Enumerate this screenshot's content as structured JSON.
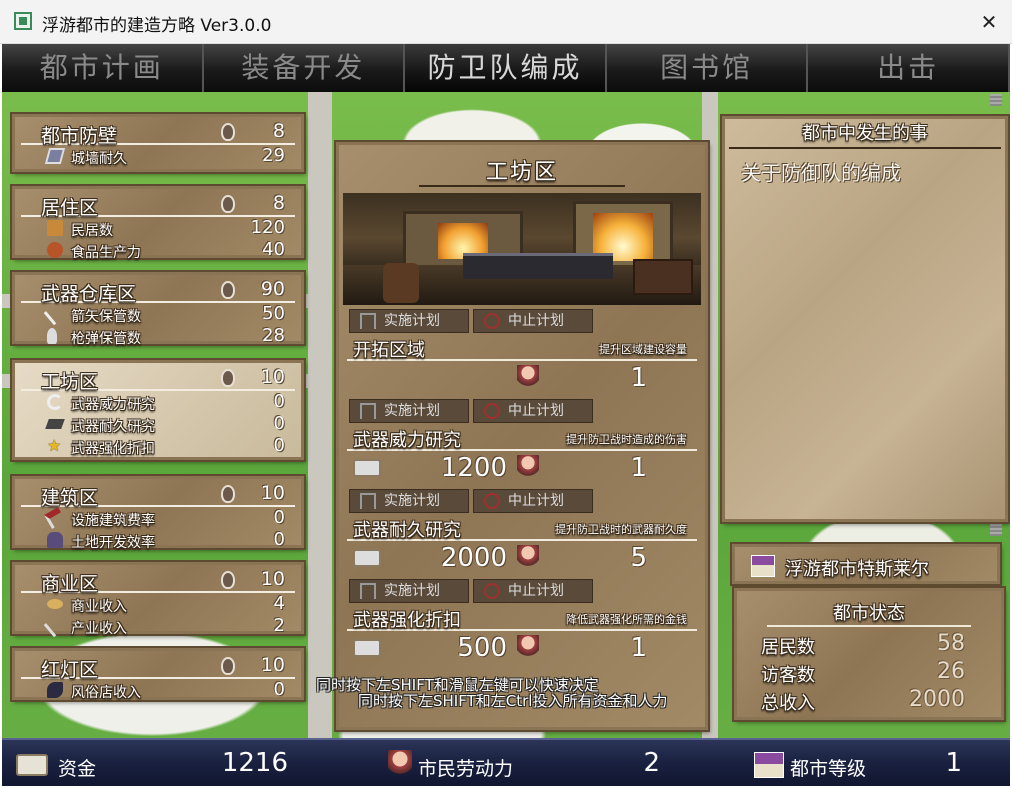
{
  "window": {
    "title": "浮游都市的建造方略 Ver3.0.0",
    "close_glyph": "✕"
  },
  "menu": [
    {
      "label": "都市计画",
      "active": false
    },
    {
      "label": "装备开发",
      "active": false
    },
    {
      "label": "防卫队编成",
      "active": true
    },
    {
      "label": "图书馆",
      "active": false
    },
    {
      "label": "出击",
      "active": false
    }
  ],
  "districts": [
    {
      "name": "都市防壁",
      "count": "8",
      "rows": [
        {
          "icon": "shield-icon",
          "label": "城墙耐久",
          "value": "29"
        }
      ]
    },
    {
      "name": "居住区",
      "count": "8",
      "rows": [
        {
          "icon": "house-icon",
          "label": "民居数",
          "value": "120"
        },
        {
          "icon": "bread-icon",
          "label": "食品生产力",
          "value": "40"
        }
      ]
    },
    {
      "name": "武器仓库区",
      "count": "90",
      "rows": [
        {
          "icon": "arrow-icon",
          "label": "箭矢保管数",
          "value": "50"
        },
        {
          "icon": "bullet-icon",
          "label": "枪弹保管数",
          "value": "28"
        }
      ]
    },
    {
      "name": "工坊区",
      "count": "10",
      "selected": true,
      "rows": [
        {
          "icon": "whetstone-icon",
          "label": "武器威力研究",
          "value": "0"
        },
        {
          "icon": "ingot-icon",
          "label": "武器耐久研究",
          "value": "0"
        },
        {
          "icon": "star-icon",
          "label": "武器强化折扣",
          "value": "0"
        }
      ]
    },
    {
      "name": "建筑区",
      "count": "10",
      "rows": [
        {
          "icon": "hammer-icon",
          "label": "设施建筑费率",
          "value": "0"
        },
        {
          "icon": "terrain-icon",
          "label": "土地开发效率",
          "value": "0"
        }
      ]
    },
    {
      "name": "商业区",
      "count": "10",
      "rows": [
        {
          "icon": "coin-icon",
          "label": "商业收入",
          "value": "4"
        },
        {
          "icon": "wrench-icon",
          "label": "产业收入",
          "value": "2"
        }
      ]
    },
    {
      "name": "红灯区",
      "count": "10",
      "rows": [
        {
          "icon": "dancer-icon",
          "label": "风俗店收入",
          "value": "0"
        }
      ]
    }
  ],
  "workshop": {
    "title": "工坊区",
    "execute_label": "实施计划",
    "stop_label": "中止计划",
    "plans": [
      {
        "name": "开拓区域",
        "desc": "提升区域建设容量",
        "cost": "",
        "workers": "1"
      },
      {
        "name": "武器威力研究",
        "desc": "提升防卫战时造成的伤害",
        "cost": "1200",
        "workers": "1"
      },
      {
        "name": "武器耐久研究",
        "desc": "提升防卫战时的武器耐久度",
        "cost": "2000",
        "workers": "5"
      },
      {
        "name": "武器强化折扣",
        "desc": "降低武器强化所需的金钱",
        "cost": "500",
        "workers": "1"
      }
    ]
  },
  "events": {
    "heading": "都市中发生的事",
    "text": "关于防御队的编成"
  },
  "city": {
    "name": "浮游都市特斯莱尔"
  },
  "status": {
    "heading": "都市状态",
    "rows": [
      {
        "label": "居民数",
        "value": "58"
      },
      {
        "label": "访客数",
        "value": "26"
      },
      {
        "label": "总收入",
        "value": "2000"
      }
    ]
  },
  "hints": {
    "line1": "同时按下左SHIFT和滑鼠左键可以快速决定",
    "line2": "同时按下左SHIFT和左Ctrl投入所有资金和人力"
  },
  "bottom": {
    "funds_label": "资金",
    "funds": "1216",
    "labor_label": "市民劳动力",
    "labor": "2",
    "level_label": "都市等级",
    "level": "1"
  },
  "colors": {
    "parchment": "#b9a583",
    "menu_bg": "#1a1a1a",
    "bottom_bar": "#1a2140",
    "grass": "#5aa63a"
  }
}
